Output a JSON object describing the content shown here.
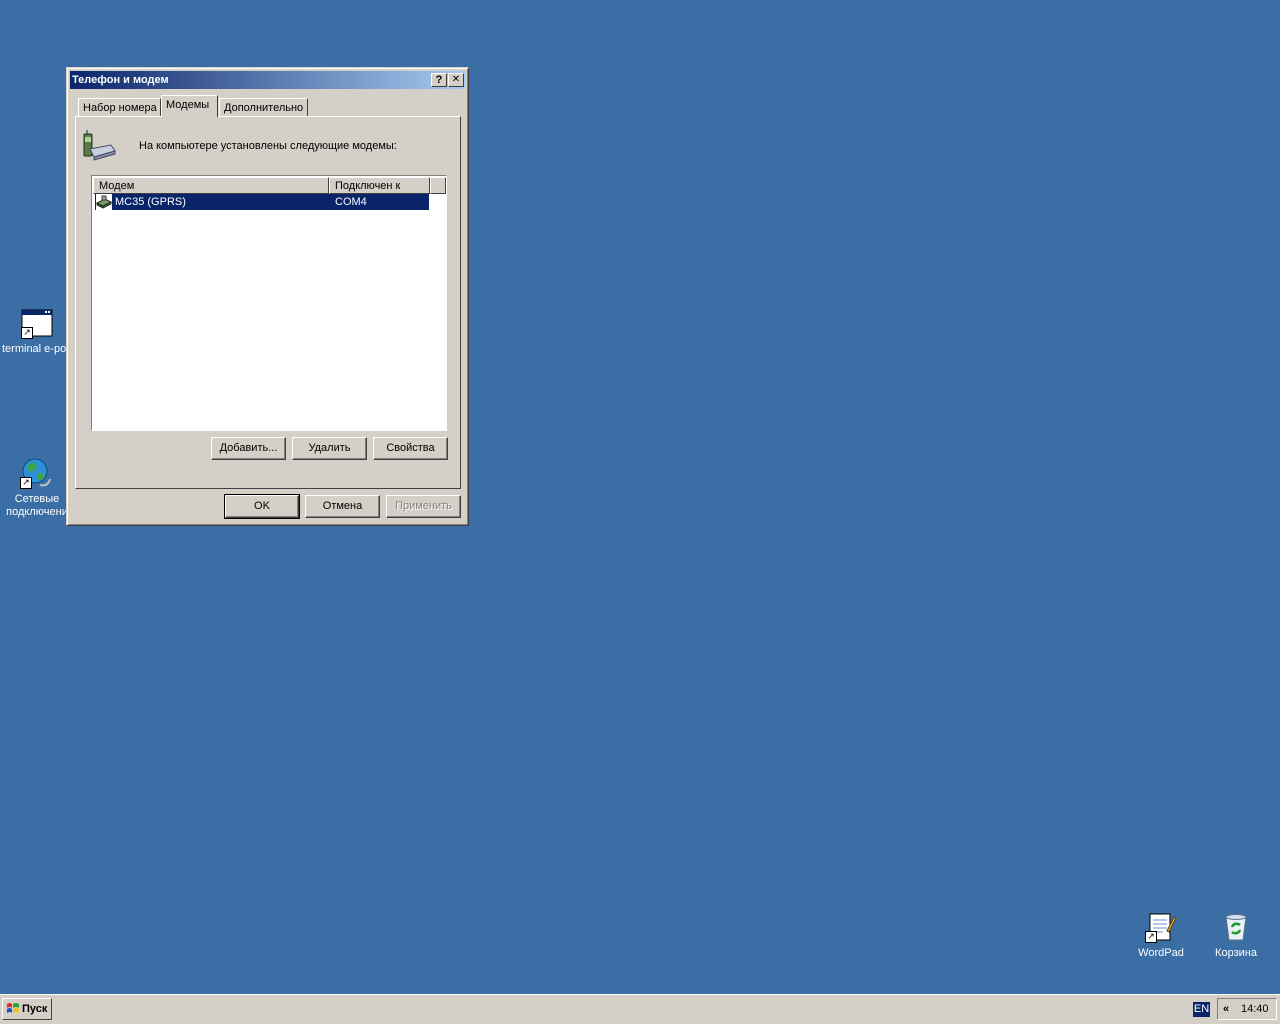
{
  "desktop": {
    "icons": [
      {
        "label": "terminal e-por"
      },
      {
        "label": "Сетевые подключени"
      },
      {
        "label": "WordPad"
      },
      {
        "label": "Корзина"
      }
    ]
  },
  "dialog": {
    "title": "Телефон и модем",
    "help_button": "?",
    "close_button": "✕",
    "tabs": [
      {
        "label": "Набор номера"
      },
      {
        "label": "Модемы"
      },
      {
        "label": "Дополнительно"
      }
    ],
    "active_tab": "Модемы",
    "description": "На компьютере установлены следующие модемы:",
    "list": {
      "columns": [
        "Модем",
        "Подключен к"
      ],
      "rows": [
        {
          "modem": "MC35 (GPRS)",
          "port": "COM4",
          "selected": true
        }
      ]
    },
    "buttons": {
      "add": "Добавить...",
      "remove": "Удалить",
      "properties": "Свойства",
      "ok": "OK",
      "cancel": "Отмена",
      "apply": "Применить"
    }
  },
  "taskbar": {
    "start_label": "Пуск",
    "language": "EN",
    "tray_chevron": "«",
    "clock": "14:40"
  },
  "colors": {
    "desktop": "#3a6ea5",
    "title_active": "#0a246a",
    "selection": "#0a246a",
    "face": "#d4d0c8"
  }
}
